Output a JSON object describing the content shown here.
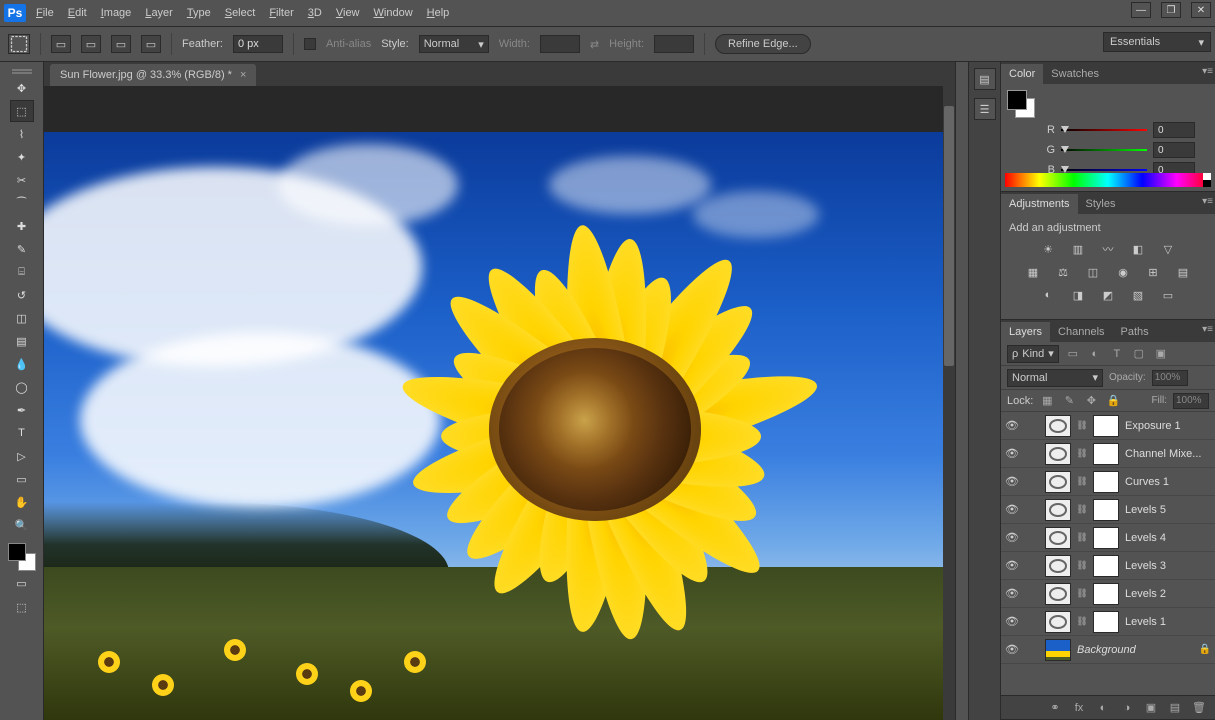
{
  "app": {
    "logo": "Ps"
  },
  "menu": [
    "File",
    "Edit",
    "Image",
    "Layer",
    "Type",
    "Select",
    "Filter",
    "3D",
    "View",
    "Window",
    "Help"
  ],
  "window_controls": {
    "min": "—",
    "max": "❐",
    "close": "✕"
  },
  "options": {
    "feather_label": "Feather:",
    "feather_value": "0 px",
    "antialias_label": "Anti-alias",
    "style_label": "Style:",
    "style_value": "Normal",
    "width_label": "Width:",
    "width_value": "",
    "height_label": "Height:",
    "height_value": "",
    "refine": "Refine Edge..."
  },
  "workspace": "Essentials",
  "tab": {
    "title": "Sun Flower.jpg @ 33.3% (RGB/8) *"
  },
  "color_panel": {
    "tabs": [
      "Color",
      "Swatches"
    ],
    "channels": [
      {
        "label": "R",
        "value": "0",
        "grad": "linear-gradient(90deg,#000,#f00)"
      },
      {
        "label": "G",
        "value": "0",
        "grad": "linear-gradient(90deg,#000,#0f0)"
      },
      {
        "label": "B",
        "value": "0",
        "grad": "linear-gradient(90deg,#000,#00f)"
      }
    ]
  },
  "adjustments": {
    "tabs": [
      "Adjustments",
      "Styles"
    ],
    "title": "Add an adjustment"
  },
  "layers_panel": {
    "tabs": [
      "Layers",
      "Channels",
      "Paths"
    ],
    "filter": "Kind",
    "blend": "Normal",
    "opacity_label": "Opacity:",
    "opacity_value": "100%",
    "lock_label": "Lock:",
    "fill_label": "Fill:",
    "fill_value": "100%",
    "layers": [
      {
        "name": "Exposure 1",
        "adj": true
      },
      {
        "name": "Channel Mixe...",
        "adj": true
      },
      {
        "name": "Curves 1",
        "adj": true
      },
      {
        "name": "Levels 5",
        "adj": true
      },
      {
        "name": "Levels 4",
        "adj": true
      },
      {
        "name": "Levels 3",
        "adj": true
      },
      {
        "name": "Levels 2",
        "adj": true
      },
      {
        "name": "Levels 1",
        "adj": true
      },
      {
        "name": "Background",
        "adj": false,
        "bg": true,
        "locked": true
      }
    ]
  },
  "tools": [
    "move",
    "marquee",
    "lasso",
    "wand",
    "crop",
    "eyedropper",
    "heal",
    "brush",
    "stamp",
    "history",
    "eraser",
    "gradient",
    "blur",
    "dodge",
    "pen",
    "type",
    "path-select",
    "shape",
    "hand",
    "zoom"
  ]
}
